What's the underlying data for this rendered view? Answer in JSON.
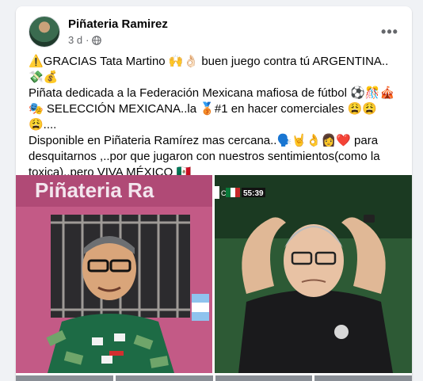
{
  "post": {
    "author": "Piñateria Ramirez",
    "time": "3 d",
    "separator": "·",
    "more_label": "•••",
    "lines": [
      "⚠️GRACIAS Tata Martino 🙌👌🏻 buen juego contra tú ARGENTINA..💸💰",
      "Piñata dedicada a la Federación Mexicana mafiosa de fútbol ⚽🎊🎪🎭 SELECCIÓN MEXICANA..la 🥉#1 en hacer comerciales 😩😩😩....",
      "Disponible en Piñateria Ramírez mas cercana..🗣️🤘👌👩❤️ para desquitarnos ,..por que jugaron con nuestros sentimientos(como la toxica)..pero VIVA MÉXICO 🇲🇽"
    ]
  },
  "media": {
    "left_sign_text": "Piñateria Ra",
    "scoreboard": {
      "channel": "C",
      "clock": "55:39"
    }
  },
  "colors": {
    "wall": "#c35a86",
    "pitch": "#1b3a22",
    "link": "#216fdb"
  },
  "icons": {
    "globe": "globe-icon",
    "more": "more-options-icon"
  }
}
